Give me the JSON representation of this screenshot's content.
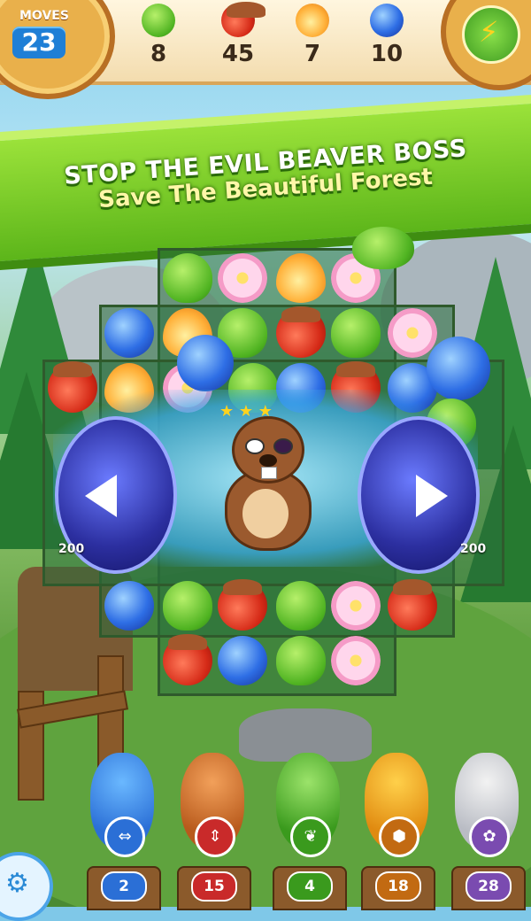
{
  "hud": {
    "moves_label": "MOVES",
    "moves_value": "23",
    "goals": [
      {
        "icon": "leaf-icon",
        "count": "8",
        "color": "#4fb321"
      },
      {
        "icon": "acorn-icon",
        "count": "45",
        "color": "#d52a17"
      },
      {
        "icon": "drop-icon",
        "count": "7",
        "color": "#ffb13a"
      },
      {
        "icon": "berry-icon",
        "count": "10",
        "color": "#2e6ee5"
      }
    ],
    "power_icon": "lightning-icon"
  },
  "banner": {
    "line1": "STOP THE EVIL BEAVER BOSS",
    "line2": "Save The Beautiful Forest"
  },
  "board": {
    "score_left": "200",
    "score_right": "200"
  },
  "helpers": [
    {
      "name": "bird",
      "count": "2",
      "emblem": "swap-arrows-icon",
      "color": "#2b6fd6"
    },
    {
      "name": "squirrel",
      "count": "15",
      "emblem": "up-down-arrows-icon",
      "color": "#c92a2a"
    },
    {
      "name": "frog",
      "count": "4",
      "emblem": "leaf-icon",
      "color": "#3a9a1d"
    },
    {
      "name": "bee",
      "count": "18",
      "emblem": "hexagon-icon",
      "color": "#c26a12"
    },
    {
      "name": "bunny",
      "count": "28",
      "emblem": "candy-icon",
      "color": "#7a4bb0"
    }
  ],
  "settings_icon": "gear-icon"
}
